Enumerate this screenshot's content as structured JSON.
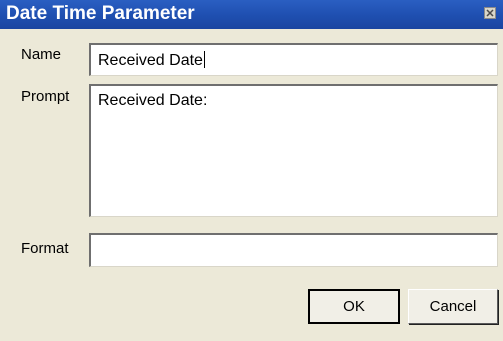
{
  "window": {
    "title": "Date Time Parameter",
    "close_icon": "close-icon"
  },
  "form": {
    "name_label": "Name",
    "name_value": "Received Date",
    "prompt_label": "Prompt",
    "prompt_value": "Received Date:",
    "format_label": "Format",
    "format_value": ""
  },
  "buttons": {
    "ok_label": "OK",
    "cancel_label": "Cancel"
  },
  "colors": {
    "titlebar": "#1f4fb0",
    "dialog_bg": "#ece9d8"
  }
}
